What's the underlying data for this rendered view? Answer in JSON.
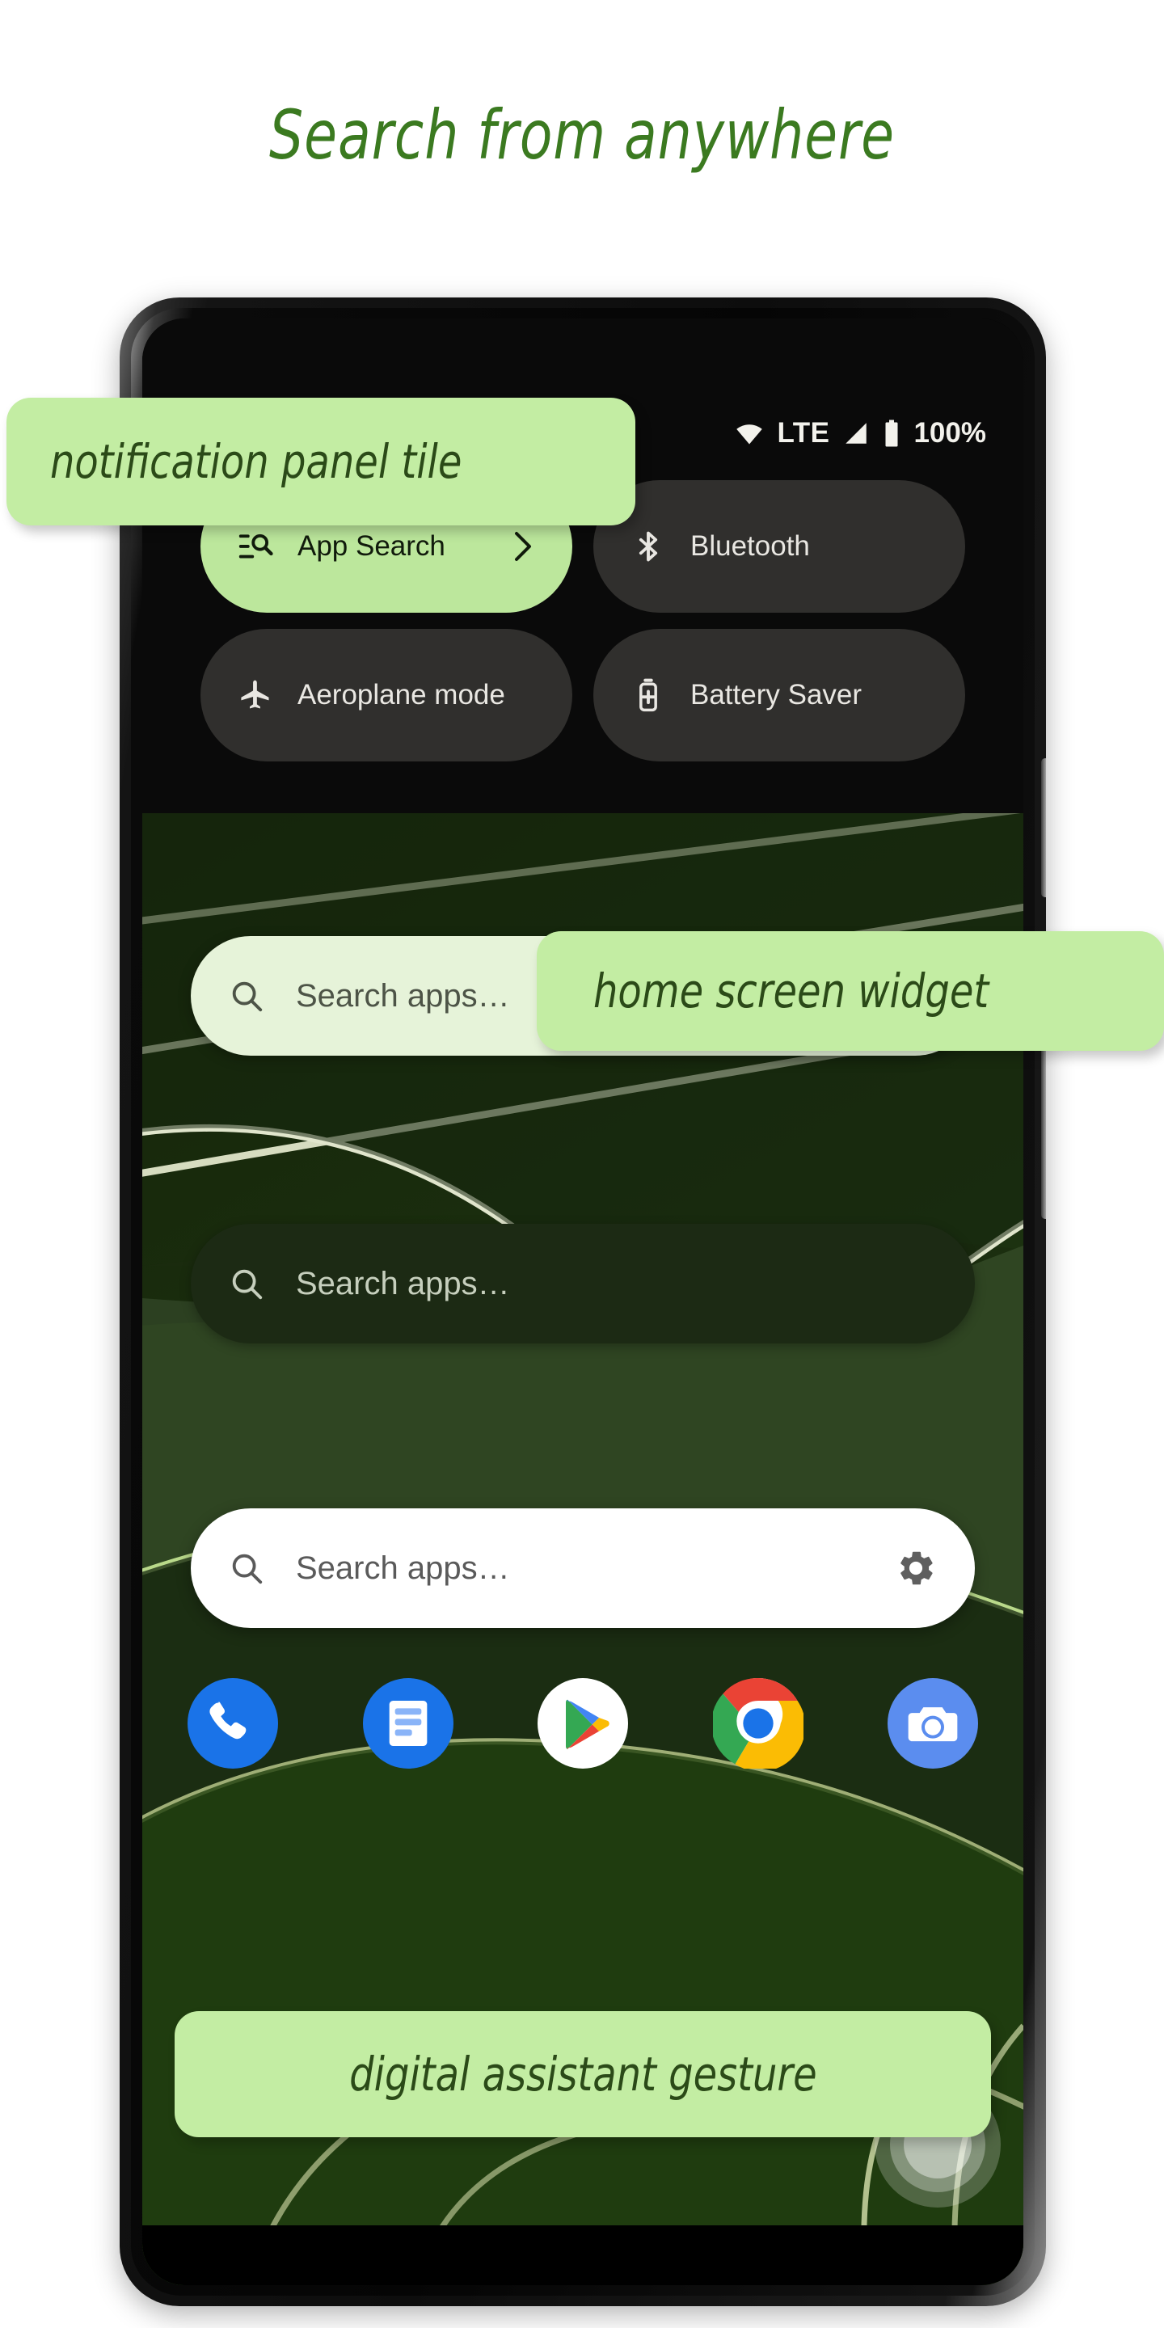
{
  "headline": "Search from anywhere",
  "theme": {
    "accent_green": "#3b7a20",
    "callout_bg": "#c3eda3",
    "callout_text": "#2b4a18",
    "tile_active_bg": "#bce79c",
    "tile_inactive_bg": "#302f2d",
    "wallpaper_green": "#2c4021",
    "wallpaper_dark_green": "#16260e",
    "wallpaper_line": "#d8ddc2"
  },
  "callouts": [
    {
      "id": "notification-panel-tile",
      "label": "notification panel tile"
    },
    {
      "id": "home-screen-widget",
      "label": "home screen widget"
    },
    {
      "id": "digital-assistant-gesture",
      "label": "digital assistant gesture"
    }
  ],
  "phone": {
    "status_bar": {
      "wifi_icon": "wifi-icon",
      "network_label": "LTE",
      "signal_icon": "signal-bars-icon",
      "battery_icon": "battery-icon",
      "battery_label": "100%"
    },
    "quick_settings": {
      "tiles": [
        {
          "label": "App Search",
          "icon": "manage-search-icon",
          "active": true,
          "chevron": "chevron-right-icon"
        },
        {
          "label": "Bluetooth",
          "icon": "bluetooth-icon",
          "active": false,
          "chevron": ""
        },
        {
          "label": "Aeroplane mode",
          "icon": "airplane-icon",
          "active": false,
          "chevron": ""
        },
        {
          "label": "Battery Saver",
          "icon": "battery-saver-icon",
          "active": false,
          "chevron": ""
        }
      ]
    },
    "home_screen": {
      "widgets": [
        {
          "style": "light",
          "placeholder": "Search apps…",
          "icon": "search-icon",
          "trailing_icon": ""
        },
        {
          "style": "dark",
          "placeholder": "Search apps…",
          "icon": "search-icon",
          "trailing_icon": ""
        },
        {
          "style": "white",
          "placeholder": "Search apps…",
          "icon": "search-icon",
          "trailing_icon": "gear-icon"
        }
      ],
      "dock": [
        {
          "name": "phone-app-icon",
          "label": "Phone"
        },
        {
          "name": "messages-app-icon",
          "label": "Messages"
        },
        {
          "name": "play-store-app-icon",
          "label": "Play Store"
        },
        {
          "name": "chrome-app-icon",
          "label": "Chrome"
        },
        {
          "name": "camera-app-icon",
          "label": "Camera"
        }
      ],
      "gesture_indicator": "assistant-gesture-ripple",
      "nav_gesture_bar": "home-gesture-bar"
    }
  }
}
